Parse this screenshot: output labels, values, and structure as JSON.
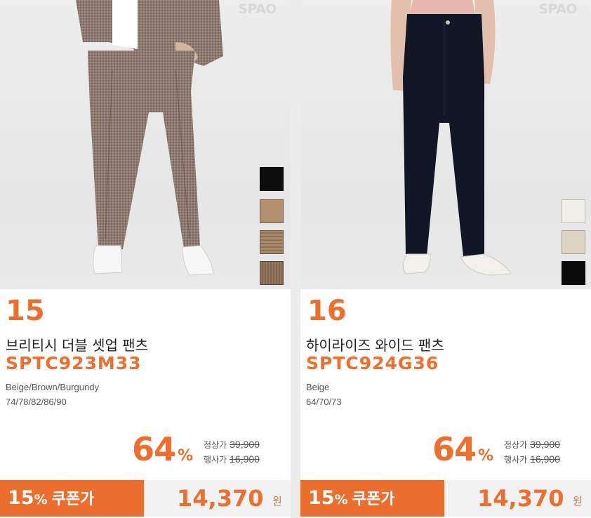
{
  "products": [
    {
      "brand_logo": "SPAO",
      "rank": "15",
      "name": "브리티시 더블 셋업 팬츠",
      "code": "SPTC923M33",
      "colors": "Beige/Brown/Burgundy",
      "sizes": "74/78/82/86/90",
      "discount": "64",
      "discount_unit": "%",
      "regular_label": "정상가",
      "regular_price": "39,900",
      "sale_label": "행사가",
      "sale_price": "16,900",
      "coupon_percent": "15",
      "coupon_percent_sign": "%",
      "coupon_label": "쿠폰가",
      "coupon_price": "14,370",
      "currency": "원",
      "swatch_colors": [
        "#0d0d0d",
        "#b3906f",
        "#9c8361",
        "#8b6f58"
      ]
    },
    {
      "brand_logo": "SPAO",
      "rank": "16",
      "name": "하이라이즈 와이드 팬츠",
      "code": "SPTC924G36",
      "colors": "Beige",
      "sizes": "64/70/73",
      "discount": "64",
      "discount_unit": "%",
      "regular_label": "정상가",
      "regular_price": "39,900",
      "sale_label": "행사가",
      "sale_price": "16,900",
      "coupon_percent": "15",
      "coupon_percent_sign": "%",
      "coupon_label": "쿠폰가",
      "coupon_price": "14,370",
      "currency": "원",
      "swatch_colors": [
        "#f1eee8",
        "#ddd3c2",
        "#0b0b0b"
      ]
    }
  ],
  "colors": {
    "accent": "#ee6f2d",
    "coupon_bg": "#ec6e2e"
  }
}
